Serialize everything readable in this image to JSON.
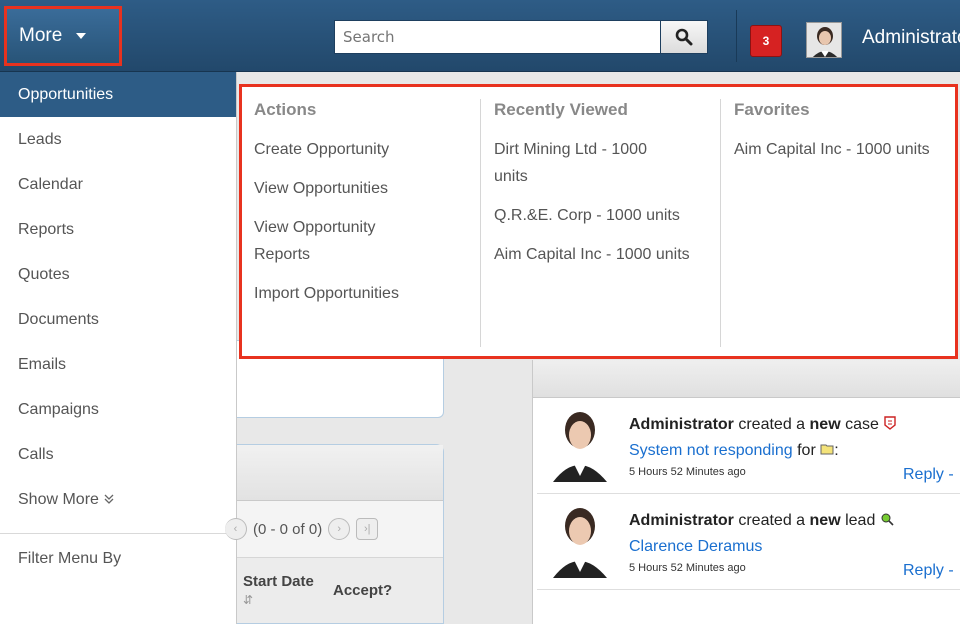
{
  "topbar": {
    "more_label": "More",
    "search_placeholder": "Search",
    "notification_count": "3",
    "user_name": "Administrator"
  },
  "side_menu": {
    "items": [
      {
        "label": "Opportunities",
        "active": true
      },
      {
        "label": "Leads"
      },
      {
        "label": "Calendar"
      },
      {
        "label": "Reports"
      },
      {
        "label": "Quotes"
      },
      {
        "label": "Documents"
      },
      {
        "label": "Emails"
      },
      {
        "label": "Campaigns"
      },
      {
        "label": "Calls"
      }
    ],
    "show_more": "Show More",
    "show_more_icon": "double-chevron-down-icon",
    "filter": "Filter Menu By"
  },
  "mega": {
    "actions": {
      "heading": "Actions",
      "items": [
        "Create Opportunity",
        "View Opportunities",
        "View Opportunity Reports",
        "Import Opportunities"
      ]
    },
    "recent": {
      "heading": "Recently Viewed",
      "items": [
        "Dirt Mining Ltd - 1000 units",
        "Q.R.&E. Corp - 1000 units",
        "Aim Capital Inc - 1000 units"
      ]
    },
    "favorites": {
      "heading": "Favorites",
      "items": [
        "Aim Capital Inc - 1000 units"
      ]
    }
  },
  "background": {
    "pager": "(0 - 0 of 0)",
    "col_start_date": "Start Date",
    "col_accept": "Accept?",
    "feed": [
      {
        "actor": "Administrator",
        "pre": " created a ",
        "bold": "new",
        "post": " case",
        "link": "System not responding",
        "after": " for ",
        "time": "5 Hours 52 Minutes ago",
        "reply": "Reply -"
      },
      {
        "actor": "Administrator",
        "pre": " created a ",
        "bold": "new",
        "post": " lead",
        "link": "Clarence Deramus",
        "after": "",
        "time": "5 Hours 52 Minutes ago",
        "reply": "Reply -"
      }
    ]
  },
  "colors": {
    "topbar": "#2a5680",
    "highlight": "#e8321f",
    "active_item": "#2d5c86",
    "link": "#1a6fcf"
  }
}
